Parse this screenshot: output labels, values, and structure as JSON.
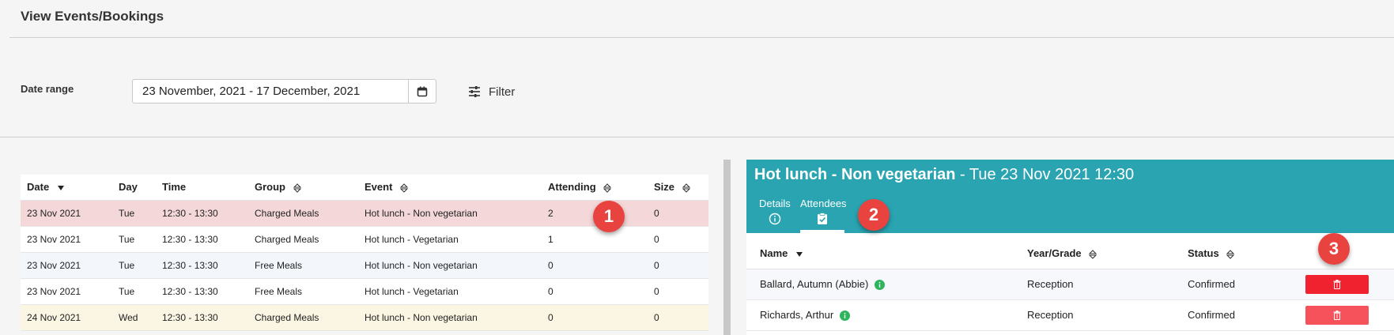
{
  "page": {
    "title": "View Events/Bookings"
  },
  "filters": {
    "date_range_label": "Date range",
    "date_range_value": "23 November, 2021 - 17 December, 2021",
    "filter_label": "Filter"
  },
  "events_table": {
    "columns": [
      "Date",
      "Day",
      "Time",
      "Group",
      "Event",
      "Attending",
      "Size"
    ],
    "rows": [
      [
        "23 Nov 2021",
        "Tue",
        "12:30 - 13:30",
        "Charged Meals",
        "Hot lunch - Non vegetarian",
        "2",
        "0"
      ],
      [
        "23 Nov 2021",
        "Tue",
        "12:30 - 13:30",
        "Charged Meals",
        "Hot lunch - Vegetarian",
        "1",
        "0"
      ],
      [
        "23 Nov 2021",
        "Tue",
        "12:30 - 13:30",
        "Free Meals",
        "Hot lunch - Non vegetarian",
        "0",
        "0"
      ],
      [
        "23 Nov 2021",
        "Tue",
        "12:30 - 13:30",
        "Free Meals",
        "Hot lunch - Vegetarian",
        "0",
        "0"
      ],
      [
        "24 Nov 2021",
        "Wed",
        "12:30 - 13:30",
        "Charged Meals",
        "Hot lunch - Non vegetarian",
        "0",
        "0"
      ]
    ]
  },
  "detail": {
    "title_event": "Hot lunch - Non vegetarian",
    "title_when": " - Tue 23 Nov 2021 12:30",
    "tabs": [
      {
        "label": "Details",
        "icon": "info-circle-icon"
      },
      {
        "label": "Attendees",
        "icon": "clipboard-check-icon",
        "active": true
      }
    ],
    "columns": [
      "Name",
      "Year/Grade",
      "Status"
    ],
    "rows": [
      [
        "Ballard, Autumn (Abbie)",
        "Reception",
        "Confirmed"
      ],
      [
        "Richards, Arthur",
        "Reception",
        "Confirmed"
      ]
    ]
  },
  "callouts": [
    "1",
    "2",
    "3"
  ],
  "colors": {
    "accent_teal": "#2aa4b1",
    "selected_row": "#f4d7d9",
    "delete_red": "#f0222f",
    "callout_red": "#e8433e",
    "info_green": "#2db55d"
  }
}
